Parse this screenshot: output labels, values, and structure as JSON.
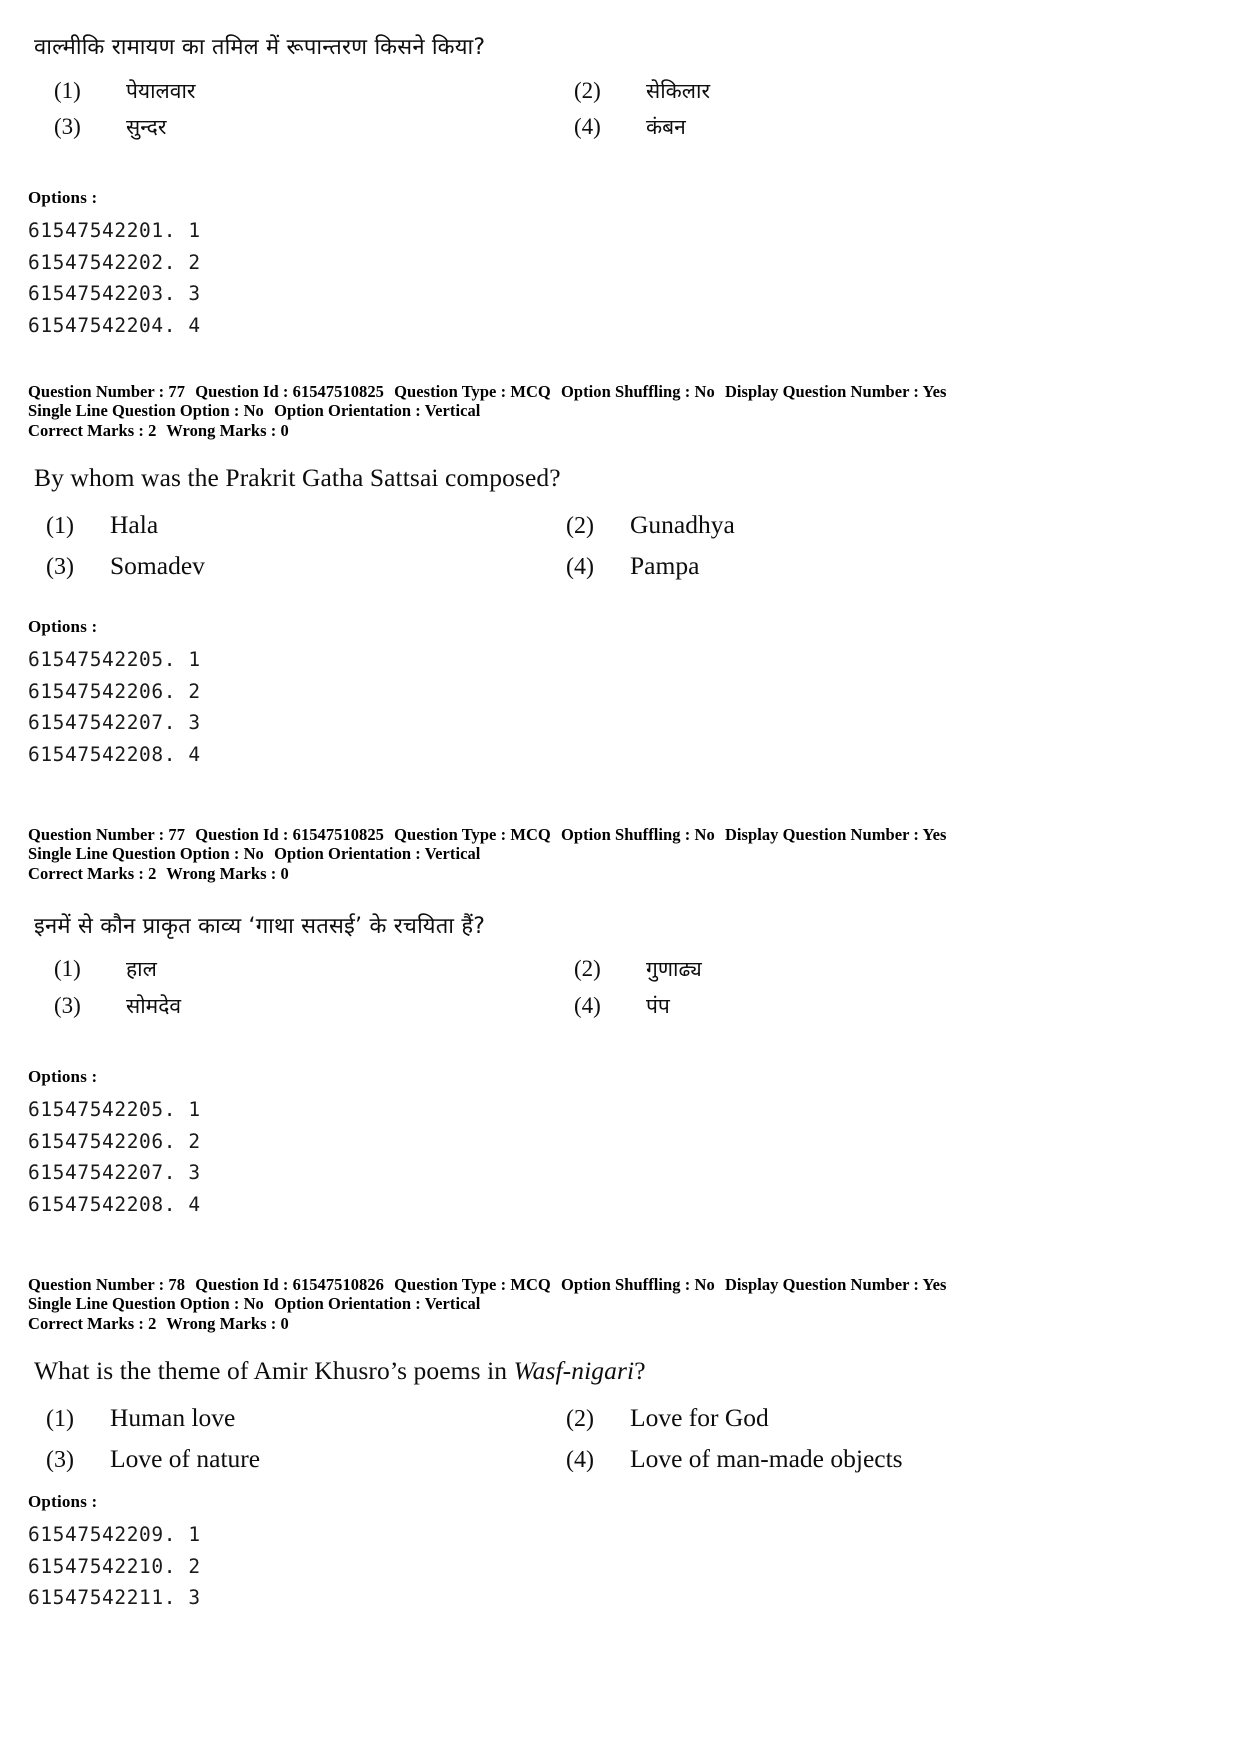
{
  "labels": {
    "options_heading": "Options :",
    "question_number": "Question Number :",
    "question_id": "Question Id :",
    "question_type": "Question Type :",
    "option_shuffling": "Option Shuffling :",
    "display_question_number": "Display Question Number :",
    "single_line_question_option": "Single Line Question Option :",
    "option_orientation": "Option Orientation :",
    "correct_marks": "Correct Marks :",
    "wrong_marks": "Wrong Marks :"
  },
  "blocks": {
    "q77_hindi_top": {
      "question": "वाल्मीकि रामायण का तमिल में रूपान्तरण किसने किया?",
      "options": [
        {
          "num": "(1)",
          "label": "पेयालवार"
        },
        {
          "num": "(2)",
          "label": "सेकिलार"
        },
        {
          "num": "(3)",
          "label": "सुन्दर"
        },
        {
          "num": "(4)",
          "label": "कंबन"
        }
      ],
      "option_ids": [
        "61547542201. 1",
        "61547542202. 2",
        "61547542203. 3",
        "61547542204. 4"
      ]
    },
    "meta_77_a": {
      "question_number": "77",
      "question_id": "61547510825",
      "question_type": "MCQ",
      "option_shuffling": "No",
      "display_question_number": "Yes",
      "single_line_question_option": "No",
      "option_orientation": "Vertical",
      "correct_marks": "2",
      "wrong_marks": "0"
    },
    "q77_english": {
      "question": "By whom was the Prakrit Gatha Sattsai composed?",
      "options": [
        {
          "num": "(1)",
          "label": "Hala"
        },
        {
          "num": "(2)",
          "label": "Gunadhya"
        },
        {
          "num": "(3)",
          "label": "Somadev"
        },
        {
          "num": "(4)",
          "label": "Pampa"
        }
      ],
      "option_ids": [
        "61547542205. 1",
        "61547542206. 2",
        "61547542207. 3",
        "61547542208. 4"
      ]
    },
    "meta_77_b": {
      "question_number": "77",
      "question_id": "61547510825",
      "question_type": "MCQ",
      "option_shuffling": "No",
      "display_question_number": "Yes",
      "single_line_question_option": "No",
      "option_orientation": "Vertical",
      "correct_marks": "2",
      "wrong_marks": "0"
    },
    "q77_hindi": {
      "question": "इनमें से कौन प्राकृत काव्य ‘गाथा सतसई’ के रचयिता हैं?",
      "options": [
        {
          "num": "(1)",
          "label": "हाल"
        },
        {
          "num": "(2)",
          "label": "गुणाढ्य"
        },
        {
          "num": "(3)",
          "label": "सोमदेव"
        },
        {
          "num": "(4)",
          "label": "पंप"
        }
      ],
      "option_ids": [
        "61547542205. 1",
        "61547542206. 2",
        "61547542207. 3",
        "61547542208. 4"
      ]
    },
    "meta_78": {
      "question_number": "78",
      "question_id": "61547510826",
      "question_type": "MCQ",
      "option_shuffling": "No",
      "display_question_number": "Yes",
      "single_line_question_option": "No",
      "option_orientation": "Vertical",
      "correct_marks": "2",
      "wrong_marks": "0"
    },
    "q78_english": {
      "question_prefix": "What is the theme of Amir Khusro’s poems in ",
      "question_italic": "Wasf-nigari",
      "question_suffix": "?",
      "options": [
        {
          "num": "(1)",
          "label": "Human love"
        },
        {
          "num": "(2)",
          "label": "Love for God"
        },
        {
          "num": "(3)",
          "label": "Love of nature"
        },
        {
          "num": "(4)",
          "label": "Love of man-made objects"
        }
      ],
      "option_ids": [
        "61547542209. 1",
        "61547542210. 2",
        "61547542211. 3"
      ]
    }
  }
}
